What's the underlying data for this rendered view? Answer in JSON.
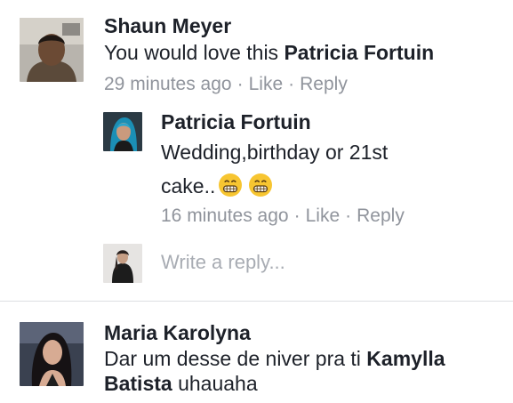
{
  "thread": {
    "comment1": {
      "author": "Shaun Meyer",
      "text_prefix": "You would love this ",
      "mention": "Patricia Fortuin",
      "time": "29 minutes ago",
      "like_label": "Like",
      "reply_label": "Reply",
      "separator": "·"
    },
    "reply1": {
      "author": "Patricia Fortuin",
      "text_line1": "Wedding,birthday or 21st",
      "text_line2": "cake..",
      "emoji_names": [
        "grimacing-face-emoji",
        "grimacing-face-emoji"
      ],
      "time": "16 minutes ago",
      "like_label": "Like",
      "reply_label": "Reply",
      "separator": "·"
    },
    "reply_box": {
      "placeholder": "Write a reply..."
    },
    "comment2": {
      "author": "Maria Karolyna",
      "text_prefix": "Dar um desse de niver pra ti ",
      "mention_first": "Kamylla",
      "mention_second": "Batista",
      "text_suffix": " uhauaha"
    }
  },
  "colors": {
    "text": "#1d2129",
    "meta": "#90949c",
    "placeholder": "#a8acb3",
    "divider": "#dddfe2",
    "emoji_fill": "#f7c531"
  }
}
